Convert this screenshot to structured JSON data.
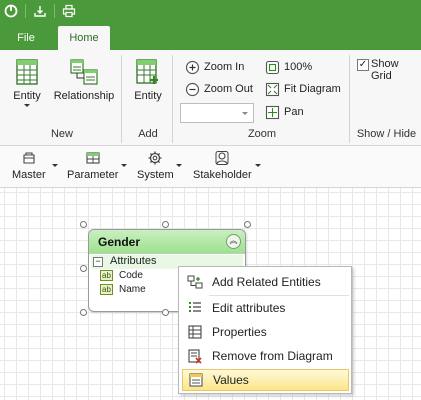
{
  "tabs": {
    "file": "File",
    "home": "Home"
  },
  "ribbon": {
    "groups": {
      "new": {
        "label": "New",
        "entity": "Entity",
        "relationship": "Relationship"
      },
      "add": {
        "label": "Add",
        "entity": "Entity"
      },
      "zoom": {
        "label": "Zoom",
        "zoom_in": "Zoom In",
        "zoom_out": "Zoom Out",
        "percent": "100%",
        "fit_diagram": "Fit Diagram",
        "pan": "Pan",
        "zoom_combo_value": ""
      },
      "show_hide": {
        "label": "Show / Hide",
        "show_grid": "Show Grid",
        "show_grid_checked": true
      }
    }
  },
  "toolbar2": {
    "items": [
      {
        "label": "Master"
      },
      {
        "label": "Parameter"
      },
      {
        "label": "System"
      },
      {
        "label": "Stakeholder"
      }
    ]
  },
  "entity": {
    "title": "Gender",
    "section": "Attributes",
    "attributes": [
      "Code",
      "Name"
    ],
    "attr_icon": "ab"
  },
  "context_menu": {
    "items": [
      {
        "label": "Add Related Entities",
        "icon": "related-entities-icon"
      },
      {
        "label": "Edit attributes",
        "icon": "attributes-list-icon"
      },
      {
        "label": "Properties",
        "icon": "properties-icon"
      },
      {
        "label": "Remove from Diagram",
        "icon": "remove-icon"
      },
      {
        "label": "Values",
        "icon": "values-icon",
        "highlighted": true
      }
    ]
  },
  "colors": {
    "accent": "#4a9a3c",
    "entity_header": "#a8e39b",
    "hover": "#fce68a"
  }
}
